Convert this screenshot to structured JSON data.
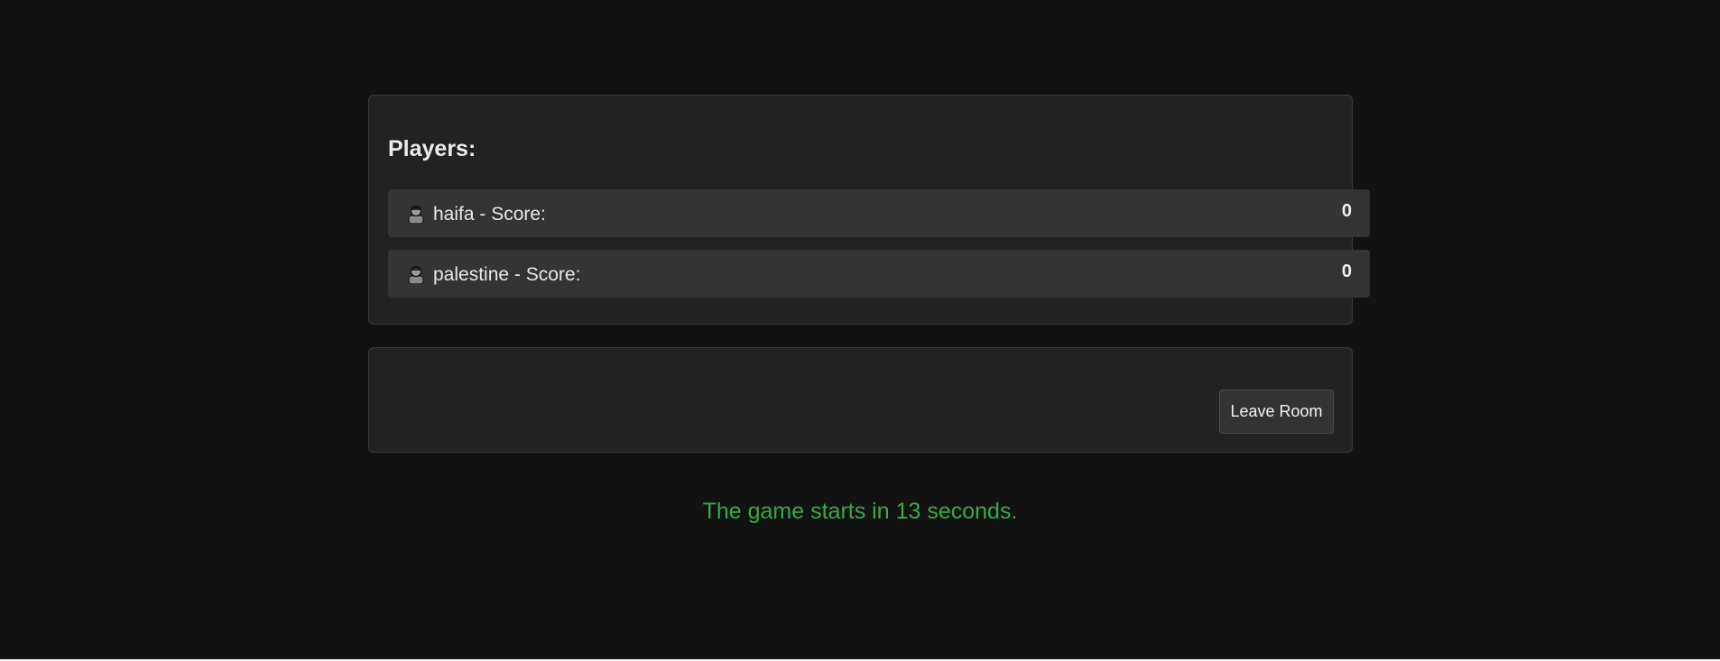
{
  "players_panel": {
    "heading": "Players:",
    "players": [
      {
        "label": "haifa - Score:",
        "score": "0",
        "icon": "user-avatar-icon"
      },
      {
        "label": "palestine - Score:",
        "score": "0",
        "icon": "user-avatar-icon"
      }
    ]
  },
  "actions": {
    "leave_label": "Leave Room"
  },
  "status": {
    "countdown": "The game starts in 13 seconds."
  },
  "colors": {
    "background": "#121212",
    "panel": "#222222",
    "row": "#343434",
    "countdown": "#3aa847"
  }
}
